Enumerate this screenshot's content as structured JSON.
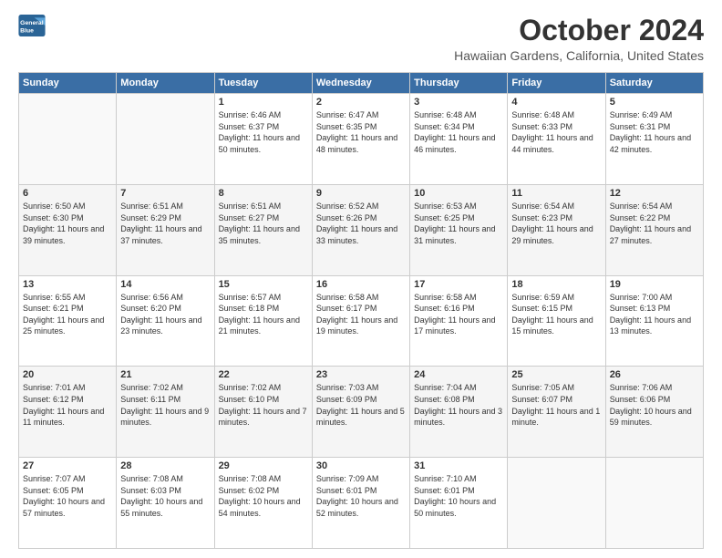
{
  "logo": {
    "line1": "General",
    "line2": "Blue"
  },
  "title": "October 2024",
  "subtitle": "Hawaiian Gardens, California, United States",
  "headers": [
    "Sunday",
    "Monday",
    "Tuesday",
    "Wednesday",
    "Thursday",
    "Friday",
    "Saturday"
  ],
  "weeks": [
    [
      {
        "day": "",
        "content": ""
      },
      {
        "day": "",
        "content": ""
      },
      {
        "day": "1",
        "content": "Sunrise: 6:46 AM\nSunset: 6:37 PM\nDaylight: 11 hours and 50 minutes."
      },
      {
        "day": "2",
        "content": "Sunrise: 6:47 AM\nSunset: 6:35 PM\nDaylight: 11 hours and 48 minutes."
      },
      {
        "day": "3",
        "content": "Sunrise: 6:48 AM\nSunset: 6:34 PM\nDaylight: 11 hours and 46 minutes."
      },
      {
        "day": "4",
        "content": "Sunrise: 6:48 AM\nSunset: 6:33 PM\nDaylight: 11 hours and 44 minutes."
      },
      {
        "day": "5",
        "content": "Sunrise: 6:49 AM\nSunset: 6:31 PM\nDaylight: 11 hours and 42 minutes."
      }
    ],
    [
      {
        "day": "6",
        "content": "Sunrise: 6:50 AM\nSunset: 6:30 PM\nDaylight: 11 hours and 39 minutes."
      },
      {
        "day": "7",
        "content": "Sunrise: 6:51 AM\nSunset: 6:29 PM\nDaylight: 11 hours and 37 minutes."
      },
      {
        "day": "8",
        "content": "Sunrise: 6:51 AM\nSunset: 6:27 PM\nDaylight: 11 hours and 35 minutes."
      },
      {
        "day": "9",
        "content": "Sunrise: 6:52 AM\nSunset: 6:26 PM\nDaylight: 11 hours and 33 minutes."
      },
      {
        "day": "10",
        "content": "Sunrise: 6:53 AM\nSunset: 6:25 PM\nDaylight: 11 hours and 31 minutes."
      },
      {
        "day": "11",
        "content": "Sunrise: 6:54 AM\nSunset: 6:23 PM\nDaylight: 11 hours and 29 minutes."
      },
      {
        "day": "12",
        "content": "Sunrise: 6:54 AM\nSunset: 6:22 PM\nDaylight: 11 hours and 27 minutes."
      }
    ],
    [
      {
        "day": "13",
        "content": "Sunrise: 6:55 AM\nSunset: 6:21 PM\nDaylight: 11 hours and 25 minutes."
      },
      {
        "day": "14",
        "content": "Sunrise: 6:56 AM\nSunset: 6:20 PM\nDaylight: 11 hours and 23 minutes."
      },
      {
        "day": "15",
        "content": "Sunrise: 6:57 AM\nSunset: 6:18 PM\nDaylight: 11 hours and 21 minutes."
      },
      {
        "day": "16",
        "content": "Sunrise: 6:58 AM\nSunset: 6:17 PM\nDaylight: 11 hours and 19 minutes."
      },
      {
        "day": "17",
        "content": "Sunrise: 6:58 AM\nSunset: 6:16 PM\nDaylight: 11 hours and 17 minutes."
      },
      {
        "day": "18",
        "content": "Sunrise: 6:59 AM\nSunset: 6:15 PM\nDaylight: 11 hours and 15 minutes."
      },
      {
        "day": "19",
        "content": "Sunrise: 7:00 AM\nSunset: 6:13 PM\nDaylight: 11 hours and 13 minutes."
      }
    ],
    [
      {
        "day": "20",
        "content": "Sunrise: 7:01 AM\nSunset: 6:12 PM\nDaylight: 11 hours and 11 minutes."
      },
      {
        "day": "21",
        "content": "Sunrise: 7:02 AM\nSunset: 6:11 PM\nDaylight: 11 hours and 9 minutes."
      },
      {
        "day": "22",
        "content": "Sunrise: 7:02 AM\nSunset: 6:10 PM\nDaylight: 11 hours and 7 minutes."
      },
      {
        "day": "23",
        "content": "Sunrise: 7:03 AM\nSunset: 6:09 PM\nDaylight: 11 hours and 5 minutes."
      },
      {
        "day": "24",
        "content": "Sunrise: 7:04 AM\nSunset: 6:08 PM\nDaylight: 11 hours and 3 minutes."
      },
      {
        "day": "25",
        "content": "Sunrise: 7:05 AM\nSunset: 6:07 PM\nDaylight: 11 hours and 1 minute."
      },
      {
        "day": "26",
        "content": "Sunrise: 7:06 AM\nSunset: 6:06 PM\nDaylight: 10 hours and 59 minutes."
      }
    ],
    [
      {
        "day": "27",
        "content": "Sunrise: 7:07 AM\nSunset: 6:05 PM\nDaylight: 10 hours and 57 minutes."
      },
      {
        "day": "28",
        "content": "Sunrise: 7:08 AM\nSunset: 6:03 PM\nDaylight: 10 hours and 55 minutes."
      },
      {
        "day": "29",
        "content": "Sunrise: 7:08 AM\nSunset: 6:02 PM\nDaylight: 10 hours and 54 minutes."
      },
      {
        "day": "30",
        "content": "Sunrise: 7:09 AM\nSunset: 6:01 PM\nDaylight: 10 hours and 52 minutes."
      },
      {
        "day": "31",
        "content": "Sunrise: 7:10 AM\nSunset: 6:01 PM\nDaylight: 10 hours and 50 minutes."
      },
      {
        "day": "",
        "content": ""
      },
      {
        "day": "",
        "content": ""
      }
    ]
  ]
}
